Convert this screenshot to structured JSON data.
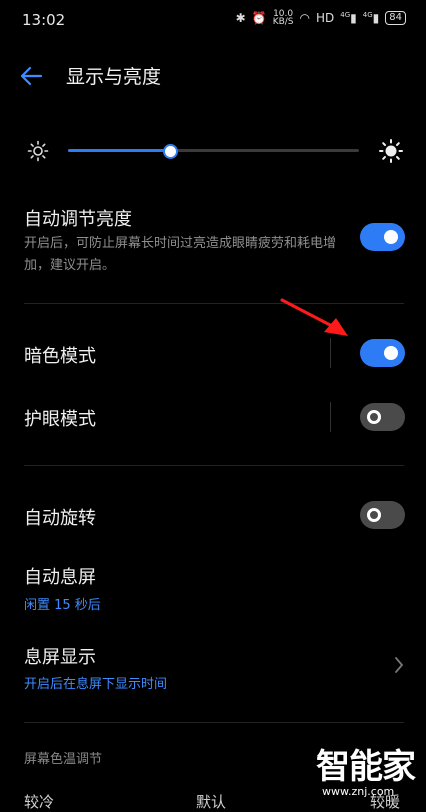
{
  "status_bar": {
    "time": "13:02",
    "net_speed_value": "10.0",
    "net_speed_unit": "KB/S",
    "hd_label": "HD",
    "signal1": "4G",
    "signal2": "4G",
    "battery": "84"
  },
  "header": {
    "title": "显示与亮度"
  },
  "brightness": {
    "level": 0.35,
    "accent_color": "#2d7cf6"
  },
  "auto_brightness": {
    "title": "自动调节亮度",
    "desc": "开启后，可防止屏幕长时间过亮造成眼睛疲劳和耗电增加，建议开启。",
    "on": true
  },
  "dark_mode": {
    "title": "暗色模式",
    "on": true
  },
  "eye_care": {
    "title": "护眼模式",
    "on": false
  },
  "auto_rotate": {
    "title": "自动旋转",
    "on": false
  },
  "auto_lock": {
    "title": "自动息屏",
    "value": "闲置 15 秒后"
  },
  "aod": {
    "title": "息屏显示",
    "desc": "开启后在息屏下显示时间"
  },
  "color_temp": {
    "section_title": "屏幕色温调节",
    "labels": [
      "较冷",
      "默认",
      "较暖"
    ]
  },
  "watermark": {
    "text": "智能家",
    "url": "www.znj.com"
  }
}
